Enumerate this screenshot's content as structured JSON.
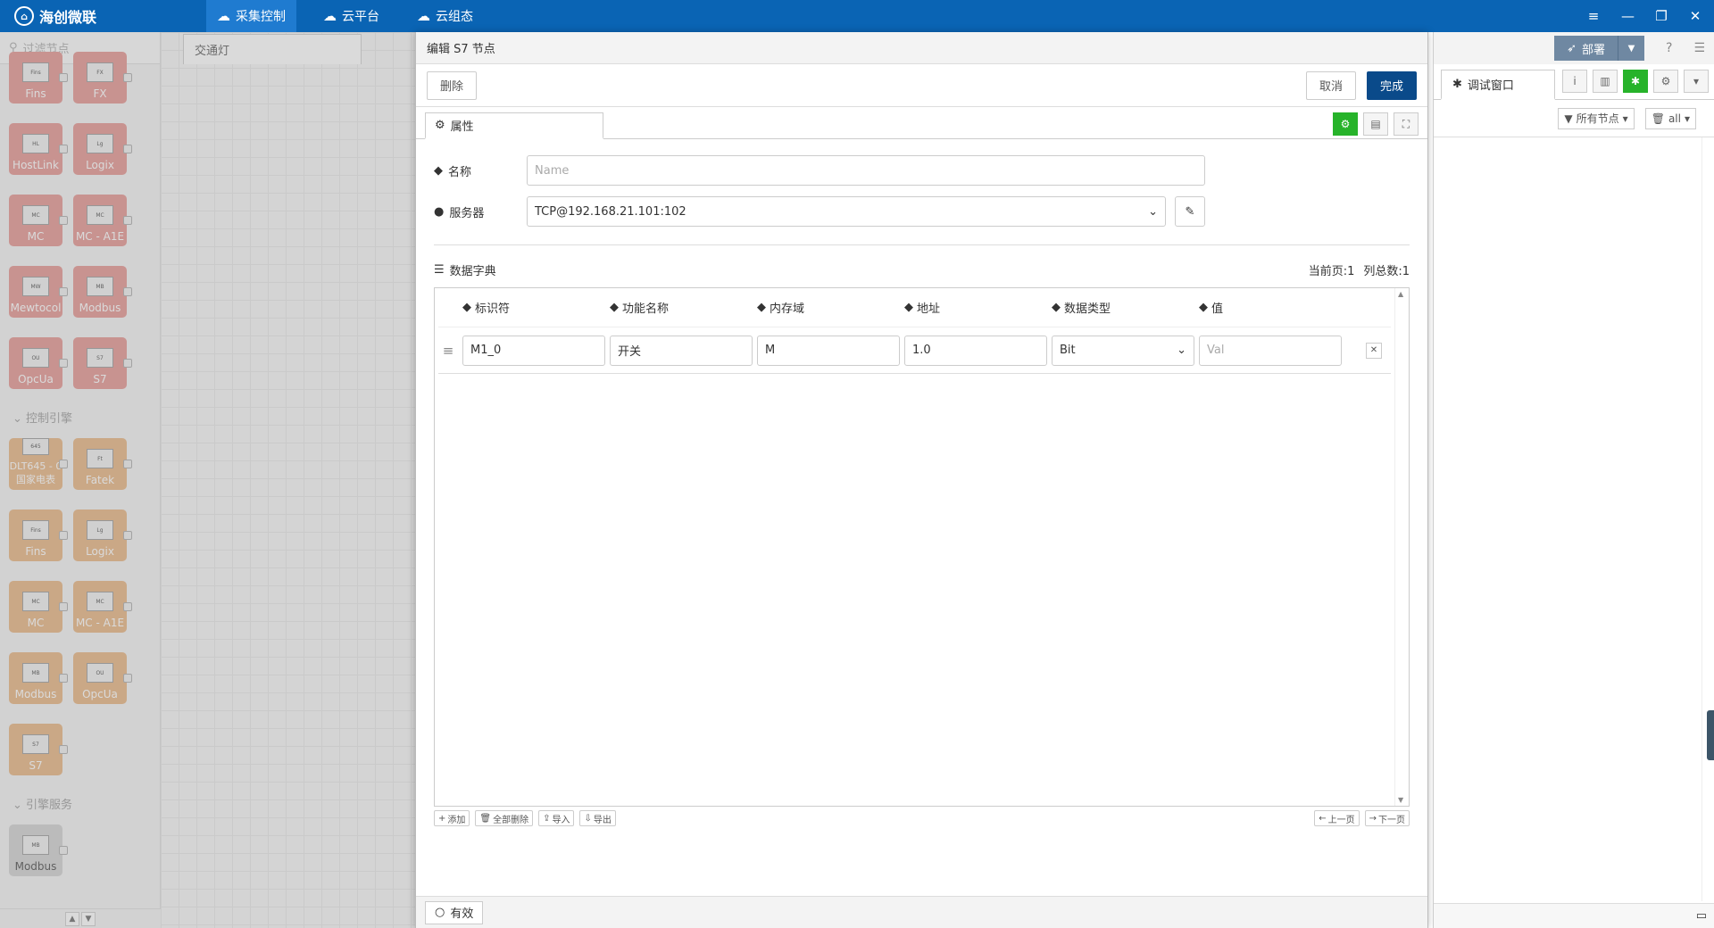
{
  "app": {
    "name": "海创微联"
  },
  "nav": {
    "items": [
      "采集控制",
      "云平台",
      "云组态"
    ]
  },
  "palette": {
    "filter_placeholder": "过滤节点",
    "group1": [
      "Fins",
      "FX",
      "HostLink",
      "Logix",
      "MC",
      "MC - A1E",
      "Mewtocol",
      "Modbus",
      "OpcUa",
      "S7"
    ],
    "cat_control": "控制引擎",
    "group2": [
      "DLT645 - 0\n国家电表",
      "Fatek",
      "Fins",
      "Logix",
      "MC",
      "MC - A1E",
      "Modbus",
      "OpcUa",
      "S7"
    ],
    "cat_service": "引擎服务",
    "group3": [
      "Modbus"
    ]
  },
  "flow": {
    "tab": "交通灯"
  },
  "editor": {
    "title": "编辑 S7 节点",
    "delete": "删除",
    "cancel": "取消",
    "done": "完成",
    "tab_props": "属性",
    "name_label": "名称",
    "name_placeholder": "Name",
    "server_label": "服务器",
    "server_value": "TCP@192.168.21.101:102",
    "dict_label": "数据字典",
    "page_info": "当前页:1",
    "col_count": "列总数:1",
    "columns": [
      "标识符",
      "功能名称",
      "内存域",
      "地址",
      "数据类型",
      "值"
    ],
    "row": {
      "id": "M1_0",
      "func": "开关",
      "mem": "M",
      "addr": "1.0",
      "type": "Bit",
      "val_placeholder": "Val"
    },
    "foot_left": [
      "添加",
      "全部删除",
      "导入",
      "导出"
    ],
    "foot_right": [
      "上一页",
      "下一页"
    ],
    "valid": "有效"
  },
  "sidebar": {
    "deploy": "部署",
    "tab": "调试窗口",
    "filter_nodes": "所有节点",
    "filter_all": "all"
  }
}
